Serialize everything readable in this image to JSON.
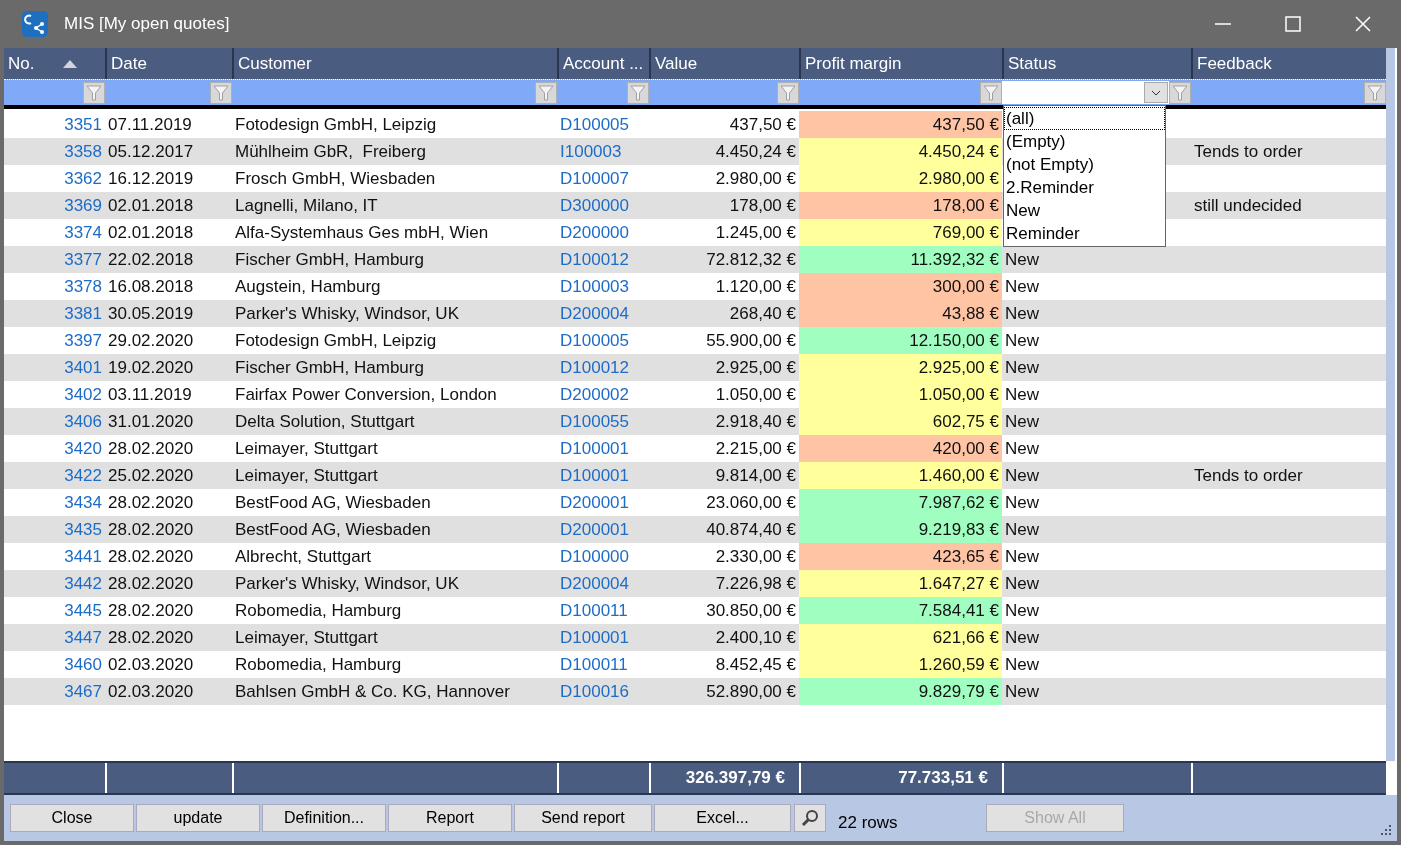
{
  "window": {
    "title": "MIS [My open quotes]"
  },
  "columns": [
    {
      "label": "No.",
      "sorted": true
    },
    {
      "label": "Date",
      "sorted": false
    },
    {
      "label": "Customer",
      "sorted": false
    },
    {
      "label": "Account ...",
      "sorted": false
    },
    {
      "label": "Value",
      "sorted": false
    },
    {
      "label": "Profit margin",
      "sorted": false
    },
    {
      "label": "Status",
      "sorted": false
    },
    {
      "label": "Feedback",
      "sorted": false
    }
  ],
  "status_filter": {
    "expanded": true,
    "options": [
      {
        "label": "(all)",
        "selected": true
      },
      {
        "label": "(Empty)",
        "selected": false
      },
      {
        "label": "(not Empty)",
        "selected": false
      },
      {
        "label": "2.Reminder",
        "selected": false
      },
      {
        "label": "New",
        "selected": false
      },
      {
        "label": "Reminder",
        "selected": false
      }
    ]
  },
  "rows": [
    {
      "no": "3351",
      "date": "07.11.2019",
      "customer": "Fotodesign GmbH, Leipzig",
      "account": "D100005",
      "value": "437,50 €",
      "margin": "437,50 €",
      "color": "#ffc4a4"
    },
    {
      "no": "3358",
      "date": "05.12.2017",
      "customer": "Mühlheim GbR,  Freiberg",
      "account": "I100003",
      "value": "4.450,24 €",
      "margin": "4.450,24 €",
      "color": "#ffff9c",
      "feedback": "Tends to order"
    },
    {
      "no": "3362",
      "date": "16.12.2019",
      "customer": "Frosch GmbH, Wiesbaden",
      "account": "D100007",
      "value": "2.980,00 €",
      "margin": "2.980,00 €",
      "color": "#ffff9c"
    },
    {
      "no": "3369",
      "date": "02.01.2018",
      "customer": "Lagnelli, Milano, IT",
      "account": "D300000",
      "value": "178,00 €",
      "margin": "178,00 €",
      "color": "#ffc4a4",
      "feedback": "still undecided"
    },
    {
      "no": "3374",
      "date": "02.01.2018",
      "customer": "Alfa-Systemhaus Ges mbH, Wien",
      "account": "D200000",
      "value": "1.245,00 €",
      "margin": "769,00 €",
      "color": "#ffff9c"
    },
    {
      "no": "3377",
      "date": "22.02.2018",
      "customer": "Fischer GmbH, Hamburg",
      "account": "D100012",
      "value": "72.812,32 €",
      "margin": "11.392,32 €",
      "color": "#a0ffc0",
      "status": "New"
    },
    {
      "no": "3378",
      "date": "16.08.2018",
      "customer": "Augstein, Hamburg",
      "account": "D100003",
      "value": "1.120,00 €",
      "margin": "300,00 €",
      "color": "#ffc4a4",
      "status": "New"
    },
    {
      "no": "3381",
      "date": "30.05.2019",
      "customer": "Parker's Whisky, Windsor, UK",
      "account": "D200004",
      "value": "268,40 €",
      "margin": "43,88 €",
      "color": "#ffc4a4",
      "status": "New"
    },
    {
      "no": "3397",
      "date": "29.02.2020",
      "customer": "Fotodesign GmbH, Leipzig",
      "account": "D100005",
      "value": "55.900,00 €",
      "margin": "12.150,00 €",
      "color": "#a0ffc0",
      "status": "New"
    },
    {
      "no": "3401",
      "date": "19.02.2020",
      "customer": "Fischer GmbH, Hamburg",
      "account": "D100012",
      "value": "2.925,00 €",
      "margin": "2.925,00 €",
      "color": "#ffff9c",
      "status": "New"
    },
    {
      "no": "3402",
      "date": "03.11.2019",
      "customer": "Fairfax Power Conversion, London",
      "account": "D200002",
      "value": "1.050,00 €",
      "margin": "1.050,00 €",
      "color": "#ffff9c",
      "status": "New"
    },
    {
      "no": "3406",
      "date": "31.01.2020",
      "customer": "Delta Solution, Stuttgart",
      "account": "D100055",
      "value": "2.918,40 €",
      "margin": "602,75 €",
      "color": "#ffff9c",
      "status": "New"
    },
    {
      "no": "3420",
      "date": "28.02.2020",
      "customer": "Leimayer, Stuttgart",
      "account": "D100001",
      "value": "2.215,00 €",
      "margin": "420,00 €",
      "color": "#ffc4a4",
      "status": "New"
    },
    {
      "no": "3422",
      "date": "25.02.2020",
      "customer": "Leimayer, Stuttgart",
      "account": "D100001",
      "value": "9.814,00 €",
      "margin": "1.460,00 €",
      "color": "#ffff9c",
      "status": "New",
      "feedback": "Tends to order"
    },
    {
      "no": "3434",
      "date": "28.02.2020",
      "customer": "BestFood AG, Wiesbaden",
      "account": "D200001",
      "value": "23.060,00 €",
      "margin": "7.987,62 €",
      "color": "#a0ffc0",
      "status": "New"
    },
    {
      "no": "3435",
      "date": "28.02.2020",
      "customer": "BestFood AG, Wiesbaden",
      "account": "D200001",
      "value": "40.874,40 €",
      "margin": "9.219,83 €",
      "color": "#a0ffc0",
      "status": "New"
    },
    {
      "no": "3441",
      "date": "28.02.2020",
      "customer": "Albrecht, Stuttgart",
      "account": "D100000",
      "value": "2.330,00 €",
      "margin": "423,65 €",
      "color": "#ffc4a4",
      "status": "New"
    },
    {
      "no": "3442",
      "date": "28.02.2020",
      "customer": "Parker's Whisky, Windsor, UK",
      "account": "D200004",
      "value": "7.226,98 €",
      "margin": "1.647,27 €",
      "color": "#ffff9c",
      "status": "New"
    },
    {
      "no": "3445",
      "date": "28.02.2020",
      "customer": "Robomedia, Hamburg",
      "account": "D100011",
      "value": "30.850,00 €",
      "margin": "7.584,41 €",
      "color": "#a0ffc0",
      "status": "New"
    },
    {
      "no": "3447",
      "date": "28.02.2020",
      "customer": "Leimayer, Stuttgart",
      "account": "D100001",
      "value": "2.400,10 €",
      "margin": "621,66 €",
      "color": "#ffff9c",
      "status": "New"
    },
    {
      "no": "3460",
      "date": "02.03.2020",
      "customer": "Robomedia, Hamburg",
      "account": "D100011",
      "value": "8.452,45 €",
      "margin": "1.260,59 €",
      "color": "#ffff9c",
      "status": "New"
    },
    {
      "no": "3467",
      "date": "02.03.2020",
      "customer": "Bahlsen GmbH & Co. KG, Hannover",
      "account": "D100016",
      "value": "52.890,00 €",
      "margin": "9.829,79 €",
      "color": "#a0ffc0",
      "status": "New"
    }
  ],
  "totals": {
    "value": "326.397,79 €",
    "margin": "77.733,51 €"
  },
  "buttons": [
    {
      "label": "Close",
      "disabled": false
    },
    {
      "label": "update",
      "disabled": false
    },
    {
      "label": "Definition...",
      "disabled": false
    },
    {
      "label": "Report",
      "disabled": false
    },
    {
      "label": "Send report",
      "disabled": false
    },
    {
      "label": "Excel...",
      "disabled": false
    }
  ],
  "row_count": "22 rows",
  "show_all": {
    "label": "Show All",
    "disabled": true
  }
}
